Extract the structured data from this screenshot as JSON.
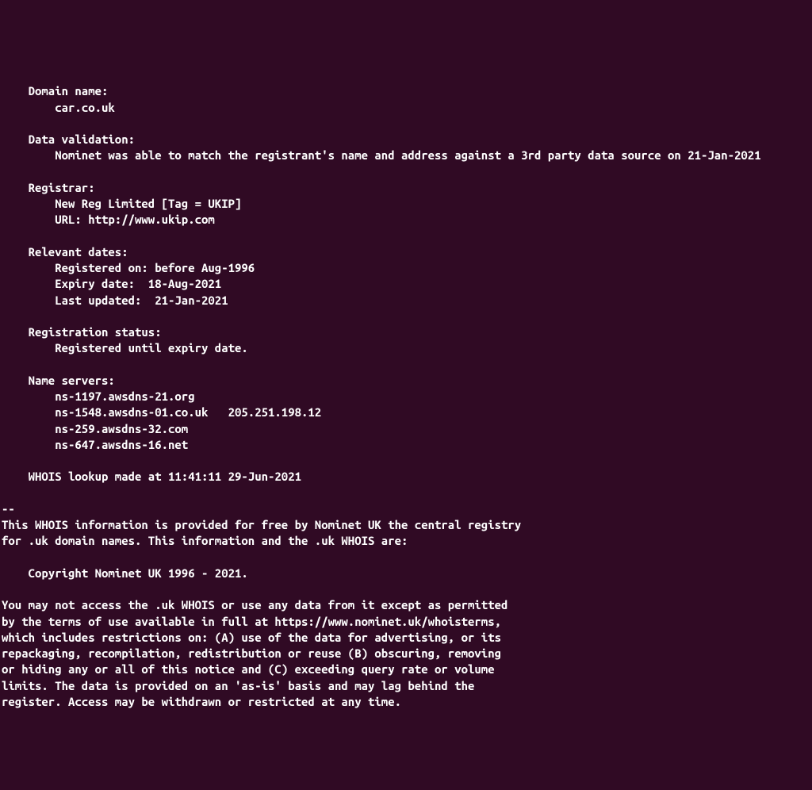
{
  "whois": {
    "domain_name_label": "Domain name:",
    "domain_name_value": "car.co.uk",
    "data_validation_label": "Data validation:",
    "data_validation_value": "Nominet was able to match the registrant's name and address against a 3rd party data source on 21-Jan-2021",
    "registrar_label": "Registrar:",
    "registrar_name": "New Reg Limited [Tag = UKIP]",
    "registrar_url": "URL: http://www.ukip.com",
    "relevant_dates_label": "Relevant dates:",
    "registered_on": "Registered on: before Aug-1996",
    "expiry_date": "Expiry date:  18-Aug-2021",
    "last_updated": "Last updated:  21-Jan-2021",
    "registration_status_label": "Registration status:",
    "registration_status_value": "Registered until expiry date.",
    "name_servers_label": "Name servers:",
    "ns1": "ns-1197.awsdns-21.org",
    "ns2": "ns-1548.awsdns-01.co.uk   205.251.198.12",
    "ns3": "ns-259.awsdns-32.com",
    "ns4": "ns-647.awsdns-16.net",
    "lookup_time": "WHOIS lookup made at 11:41:11 29-Jun-2021",
    "separator": "--",
    "info_line1": "This WHOIS information is provided for free by Nominet UK the central registry",
    "info_line2": "for .uk domain names. This information and the .uk WHOIS are:",
    "copyright": "Copyright Nominet UK 1996 - 2021.",
    "terms_line1": "You may not access the .uk WHOIS or use any data from it except as permitted",
    "terms_line2": "by the terms of use available in full at https://www.nominet.uk/whoisterms,",
    "terms_line3": "which includes restrictions on: (A) use of the data for advertising, or its",
    "terms_line4": "repackaging, recompilation, redistribution or reuse (B) obscuring, removing",
    "terms_line5": "or hiding any or all of this notice and (C) exceeding query rate or volume",
    "terms_line6": "limits. The data is provided on an 'as-is' basis and may lag behind the",
    "terms_line7": "register. Access may be withdrawn or restricted at any time."
  }
}
